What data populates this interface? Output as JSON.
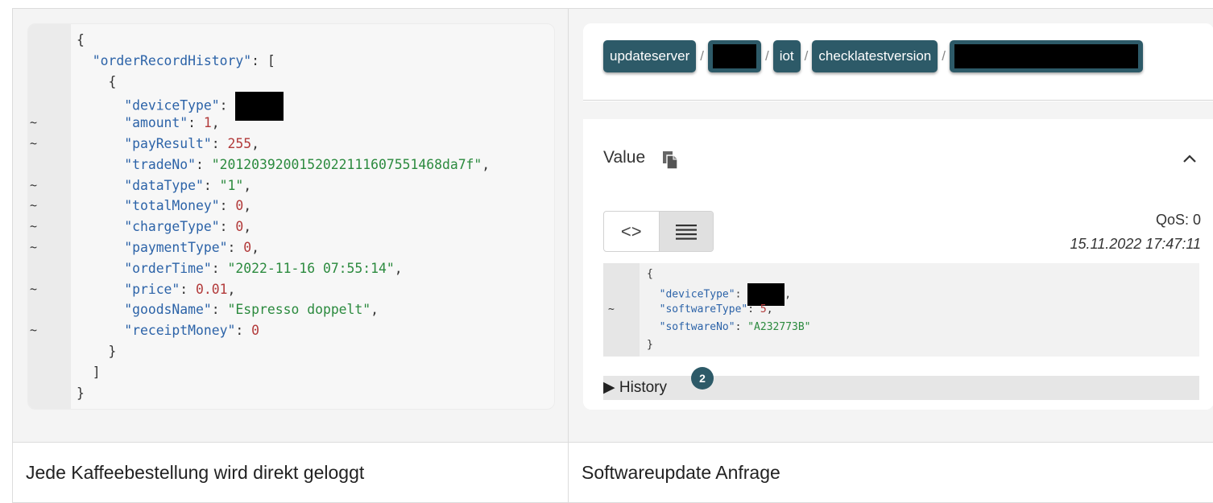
{
  "left_panel": {
    "code_lines": [
      {
        "mark": "",
        "text": "{"
      },
      {
        "mark": "",
        "key": "\"orderRecordHistory\"",
        "rest": ": ["
      },
      {
        "mark": "",
        "text": "    {"
      },
      {
        "mark": "",
        "key": "\"deviceType\"",
        "rest": ": ",
        "redacted": true
      },
      {
        "mark": "~",
        "key": "\"amount\"",
        "rest": ": ",
        "num": "1",
        "end": ","
      },
      {
        "mark": "~",
        "key": "\"payResult\"",
        "rest": ": ",
        "num": "255",
        "end": ","
      },
      {
        "mark": "",
        "key": "\"tradeNo\"",
        "rest": ": ",
        "str": "\"2012039200152022111607551468da7f\"",
        "end": ","
      },
      {
        "mark": "~",
        "key": "\"dataType\"",
        "rest": ": ",
        "str": "\"1\"",
        "end": ","
      },
      {
        "mark": "~",
        "key": "\"totalMoney\"",
        "rest": ": ",
        "num": "0",
        "end": ","
      },
      {
        "mark": "~",
        "key": "\"chargeType\"",
        "rest": ": ",
        "num": "0",
        "end": ","
      },
      {
        "mark": "~",
        "key": "\"paymentType\"",
        "rest": ": ",
        "num": "0",
        "end": ","
      },
      {
        "mark": "",
        "key": "\"orderTime\"",
        "rest": ": ",
        "str": "\"2022-11-16 07:55:14\"",
        "end": ","
      },
      {
        "mark": "~",
        "key": "\"price\"",
        "rest": ": ",
        "num": "0.01",
        "end": ","
      },
      {
        "mark": "",
        "key": "\"goodsName\"",
        "rest": ": ",
        "str": "\"Espresso doppelt\"",
        "end": ","
      },
      {
        "mark": "~",
        "key": "\"receiptMoney\"",
        "rest": ": ",
        "num": "0",
        "end": ""
      },
      {
        "mark": "",
        "text": "    }"
      },
      {
        "mark": "",
        "text": "  ]"
      },
      {
        "mark": "",
        "text": "}"
      }
    ],
    "caption": "Jede Kaffeebestellung wird direkt geloggt"
  },
  "right_panel": {
    "topic_chips": [
      "updateserver",
      "",
      "iot",
      "checklatestversion",
      ""
    ],
    "topic_separator": "/",
    "value_label": "Value",
    "qos": "QoS: 0",
    "timestamp": "15.11.2022 17:47:11",
    "toggle": {
      "code_view": "<>",
      "raw_view": "≡"
    },
    "mini_code": [
      {
        "mark": "",
        "text": "{"
      },
      {
        "mark": "",
        "key": "\"deviceType\"",
        "rest": ": ",
        "redacted": true,
        "end": ","
      },
      {
        "mark": "~",
        "key": "\"softwareType\"",
        "rest": ": ",
        "num": "5",
        "end": ","
      },
      {
        "mark": "",
        "key": "\"softwareNo\"",
        "rest": ": ",
        "str": "\"A232773B\"",
        "end": ""
      },
      {
        "mark": "",
        "text": "}"
      }
    ],
    "history_label": "▶ History",
    "history_count": "2",
    "caption": "Softwareupdate Anfrage"
  },
  "colors": {
    "chip": "#2d5a68",
    "key": "#2c63a8",
    "string": "#2b8a3e",
    "number": "#b23a3a"
  },
  "icons": [
    "copy-icon",
    "chevron-up-icon",
    "code-view-icon",
    "raw-view-icon",
    "history-triangle-icon"
  ]
}
